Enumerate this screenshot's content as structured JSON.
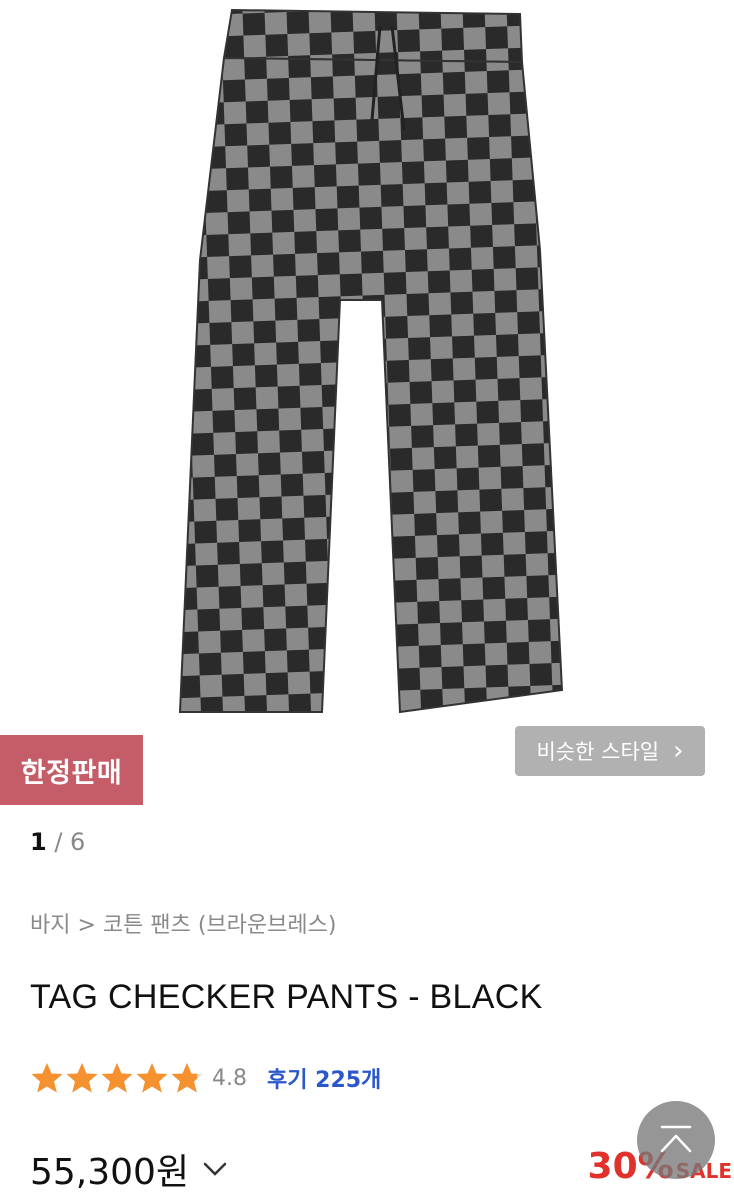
{
  "product": {
    "limited_badge": "한정판매",
    "similar_style_label": "비슷한 스타일",
    "pager": {
      "current": "1",
      "separator": " / ",
      "total": "6"
    },
    "breadcrumb": "바지 > 코튼 팬츠 (브라운브레스)",
    "title": "TAG CHECKER PANTS - BLACK",
    "rating": {
      "value": "4.8",
      "stars": 4.8,
      "max_stars": 5,
      "star_color": "#f5922f"
    },
    "reviews_label": "후기 225개",
    "price": "55,300원",
    "discount": {
      "percent": "30%",
      "sale_label": "SALE",
      "color": "#e0322b"
    }
  },
  "icons": {
    "similar_chevron": "chevron-right-icon",
    "price_chevron": "chevron-down-icon",
    "scroll_top": "arrow-up-icon"
  },
  "colors": {
    "badge_bg": "#c45d68",
    "review_link": "#2a57c9"
  }
}
